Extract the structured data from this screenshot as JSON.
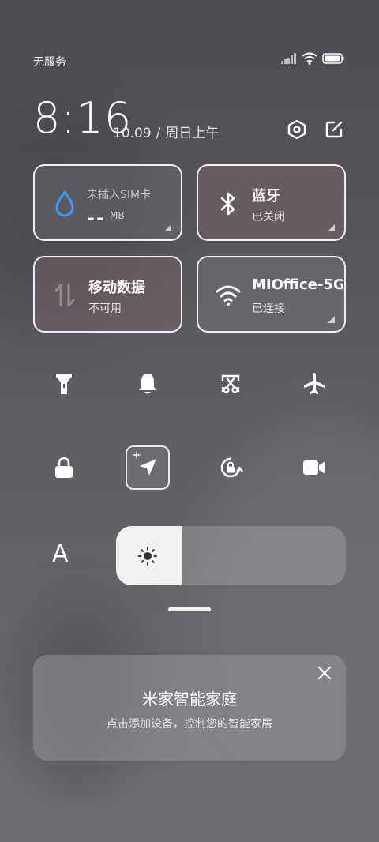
{
  "status_bar": {
    "carrier": "无服务",
    "icons": [
      "signal-icon",
      "wifi-icon",
      "battery-icon"
    ]
  },
  "header": {
    "time": "8:16",
    "date": "10.09",
    "weekday": "周日上午",
    "icons": [
      "settings-icon",
      "edit-icon"
    ]
  },
  "tiles": {
    "data_usage": {
      "label": "未插入SIM卡",
      "value": "--",
      "unit": "MB",
      "icon": "water-drop-icon"
    },
    "bluetooth": {
      "title": "蓝牙",
      "status": "已关闭",
      "icon": "bluetooth-icon"
    },
    "mobile_data": {
      "title": "移动数据",
      "status": "不可用",
      "icon": "data-arrows-icon"
    },
    "wifi": {
      "title": "MIOffice-5G",
      "status": "已连接",
      "icon": "wifi-icon"
    }
  },
  "quick_buttons": [
    {
      "name": "flashlight",
      "icon": "flashlight-icon",
      "active": false
    },
    {
      "name": "ringer",
      "icon": "bell-icon",
      "active": false
    },
    {
      "name": "screenshot",
      "icon": "screenshot-scissors-icon",
      "active": false
    },
    {
      "name": "airplane",
      "icon": "airplane-icon",
      "active": false
    },
    {
      "name": "lock",
      "icon": "lock-icon",
      "active": false
    },
    {
      "name": "location",
      "icon": "location-arrow-icon",
      "active": true
    },
    {
      "name": "rotation-lock",
      "icon": "rotation-lock-icon",
      "active": false
    },
    {
      "name": "screen-recorder",
      "icon": "video-camera-icon",
      "active": false
    }
  ],
  "brightness": {
    "font_button": "A",
    "level": 0.29
  },
  "home_card": {
    "title": "米家智能家庭",
    "subtitle": "点击添加设备，控制您的智能家居"
  }
}
